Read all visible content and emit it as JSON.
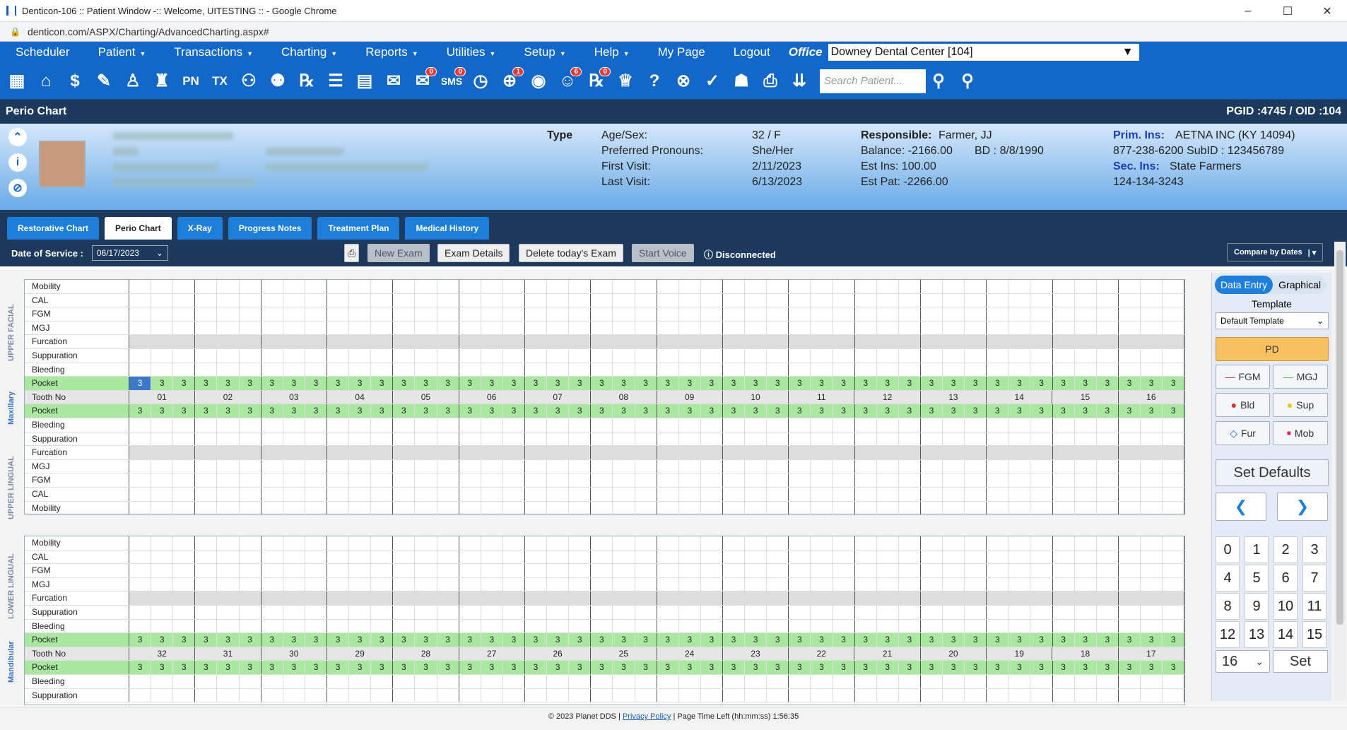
{
  "window": {
    "title": "Denticon-106 :: Patient Window -:: Welcome, UITESTING :: - Google Chrome",
    "minimize": "–",
    "maximize": "☐",
    "close": "✕",
    "url": "denticon.com/ASPX/Charting/AdvancedCharting.aspx#"
  },
  "menu": {
    "items": [
      "Scheduler",
      "Patient",
      "Transactions",
      "Charting",
      "Reports",
      "Utilities",
      "Setup",
      "Help",
      "My Page",
      "Logout"
    ],
    "office_label": "Office",
    "office_value": "Downey Dental Center [104]"
  },
  "search": {
    "placeholder": "Search Patient..."
  },
  "badges": {
    "msg": "0",
    "sms": "0",
    "globe": "1",
    "contacts": "6",
    "rx": "0"
  },
  "section": {
    "title": "Perio Chart",
    "ids": "PGID :4745  /  OID :104"
  },
  "patient": {
    "type_label": "Type",
    "agesex_label": "Age/Sex:",
    "agesex": "32 / F",
    "pronouns_label": "Preferred Pronouns:",
    "pronouns": "She/Her",
    "first_label": "First Visit:",
    "first": "2/11/2023",
    "last_label": "Last Visit:",
    "last": "6/13/2023",
    "resp_label": "Responsible:",
    "resp": "Farmer, JJ",
    "balance": "Balance:  -2166.00",
    "bd": "BD : 8/8/1990",
    "estins": "Est Ins:  100.00",
    "estpat": "Est Pat:  -2266.00",
    "prim_label": "Prim. Ins:",
    "prim": "AETNA INC (KY 14094)",
    "prim_phone": "877-238-6200 SubID : 123456789",
    "sec_label": "Sec. Ins:",
    "sec": "State Farmers",
    "sec_phone": "124-134-3243"
  },
  "tabs": [
    "Restorative Chart",
    "Perio Chart",
    "X-Ray",
    "Progress Notes",
    "Treatment Plan",
    "Medical History"
  ],
  "dos": {
    "label": "Date of Service :",
    "value": "06/17/2023",
    "new_exam": "New Exam",
    "exam_details": "Exam Details",
    "delete_exam": "Delete today's Exam",
    "start_voice": "Start Voice",
    "status": "Disconnected",
    "compare": "Compare by Dates"
  },
  "chart": {
    "upper_labels": [
      "Mobility",
      "CAL",
      "FGM",
      "MGJ",
      "Furcation",
      "Suppuration",
      "Bleeding",
      "Pocket",
      "Tooth No",
      "Pocket",
      "Bleeding",
      "Suppuration",
      "Furcation",
      "MGJ",
      "FGM",
      "CAL",
      "Mobility"
    ],
    "lower_labels": [
      "Mobility",
      "CAL",
      "FGM",
      "MGJ",
      "Furcation",
      "Suppuration",
      "Bleeding",
      "Pocket",
      "Tooth No",
      "Pocket",
      "Bleeding",
      "Suppuration"
    ],
    "upper_teeth": [
      "01",
      "02",
      "03",
      "04",
      "05",
      "06",
      "07",
      "08",
      "09",
      "10",
      "11",
      "12",
      "13",
      "14",
      "15",
      "16"
    ],
    "lower_teeth": [
      "32",
      "31",
      "30",
      "29",
      "28",
      "27",
      "26",
      "25",
      "24",
      "23",
      "22",
      "21",
      "20",
      "19",
      "18",
      "17"
    ],
    "pocket_value": "3",
    "side_labels": {
      "upper_facial": "UPPER FACIAL",
      "maxillary": "Maxillary",
      "upper_lingual": "UPPER LINGUAL",
      "lower_lingual": "LOWER LINGUAL",
      "mandibular": "Mandibular"
    }
  },
  "panel": {
    "data_entry": "Data Entry",
    "graphical": "Graphical",
    "template_label": "Template",
    "template_value": "Default Template",
    "pd": "PD",
    "fgm": "FGM",
    "mgj": "MGJ",
    "bld": "Bld",
    "sup": "Sup",
    "fur": "Fur",
    "mob": "Mob",
    "set_defaults": "Set Defaults",
    "numbers": [
      "0",
      "1",
      "2",
      "3",
      "4",
      "5",
      "6",
      "7",
      "8",
      "9",
      "10",
      "11",
      "12",
      "13",
      "14",
      "15"
    ],
    "select_value": "16",
    "set": "Set"
  },
  "footer": {
    "copyright": "© 2023 Planet DDS |",
    "privacy": "Privacy Policy",
    "time": "| Page Time Left (hh:mm:ss) 1:56:35"
  }
}
